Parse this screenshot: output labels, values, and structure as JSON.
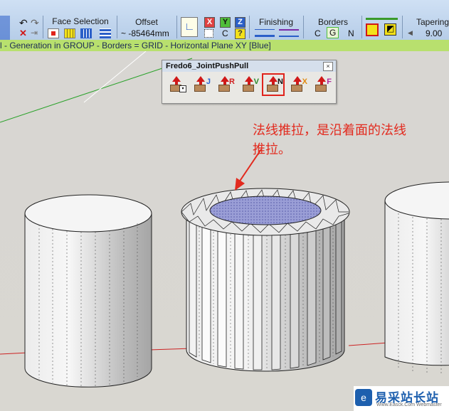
{
  "toolbar": {
    "face_selection_label": "Face Selection",
    "offset_label": "Offset",
    "offset_value": "~ -85464mm",
    "axis_x": "X",
    "axis_y": "Y",
    "axis_z": "Z",
    "c_label": "C",
    "q_label": "?",
    "finishing_label": "Finishing",
    "borders_label": "Borders",
    "borders_c": "C",
    "borders_g": "G",
    "borders_n": "N",
    "tapering_label": "Tapering",
    "tapering_value": "9.00"
  },
  "status_bar": {
    "text": "l - Generation in GROUP - Borders = GRID - Horizontal Plane XY [Blue]"
  },
  "palette": {
    "title": "Fredo6_JointPushPull",
    "close": "×",
    "tools": [
      {
        "letter": "",
        "color": "#000000"
      },
      {
        "letter": "J",
        "color": "#2a63d6"
      },
      {
        "letter": "R",
        "color": "#d02020"
      },
      {
        "letter": "V",
        "color": "#2a8a2a"
      },
      {
        "letter": "N",
        "color": "#111111"
      },
      {
        "letter": "X",
        "color": "#e08a10"
      },
      {
        "letter": "F",
        "color": "#b0289a"
      }
    ]
  },
  "annotation": {
    "line1": "法线推拉，是沿着面的法线",
    "line2": "推拉。"
  },
  "watermark": {
    "logo": "e",
    "text_cn": "易采站长站",
    "text_en": "Www.Easck.Com Webmaster"
  },
  "colors": {
    "annotation": "#e22a1e",
    "status_bar": "#b8e06e",
    "toolbar": "#c3d7ef",
    "highlight": "#e0231c"
  }
}
